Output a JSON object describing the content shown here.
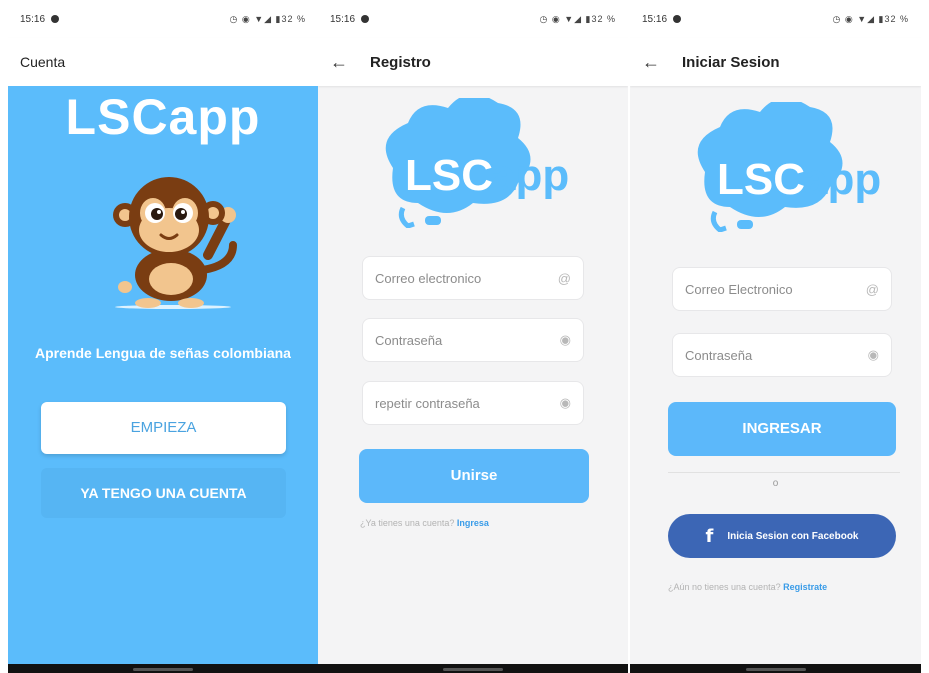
{
  "status": {
    "time1": "15:16",
    "time2": "15:16",
    "time3": "15:16",
    "battery": "32 %"
  },
  "screen1": {
    "title": "Cuenta",
    "brand": "LSCapp",
    "tagline": "Aprende Lengua de señas colombiana",
    "start_button": "EMPIEZA",
    "have_account_button": "YA TENGO UNA CUENTA"
  },
  "screen2": {
    "title": "Registro",
    "email_placeholder": "Correo electronico",
    "password_placeholder": "Contraseña",
    "repeat_placeholder": "repetir contraseña",
    "join_button": "Unirse",
    "have_account_text": "¿Ya tienes una cuenta?",
    "login_link": "Ingresa"
  },
  "screen3": {
    "title": "Iniciar Sesion",
    "email_placeholder": "Correo Electronico",
    "password_placeholder": "Contraseña",
    "login_button": "INGRESAR",
    "or_text": "o",
    "facebook_button": "Inicia Sesion con Facebook",
    "no_account_text": "¿Aún no tienes una cuenta?",
    "register_link": "Registrate"
  },
  "logo_text": {
    "part1": "LSC",
    "part2": "app"
  },
  "colors": {
    "primary": "#5bbcfb",
    "facebook": "#3c66b5",
    "link": "#3a9ce8"
  },
  "icons": {
    "back": "arrow-left-icon",
    "email": "at-sign-icon",
    "password": "eye-icon",
    "facebook": "facebook-icon"
  }
}
